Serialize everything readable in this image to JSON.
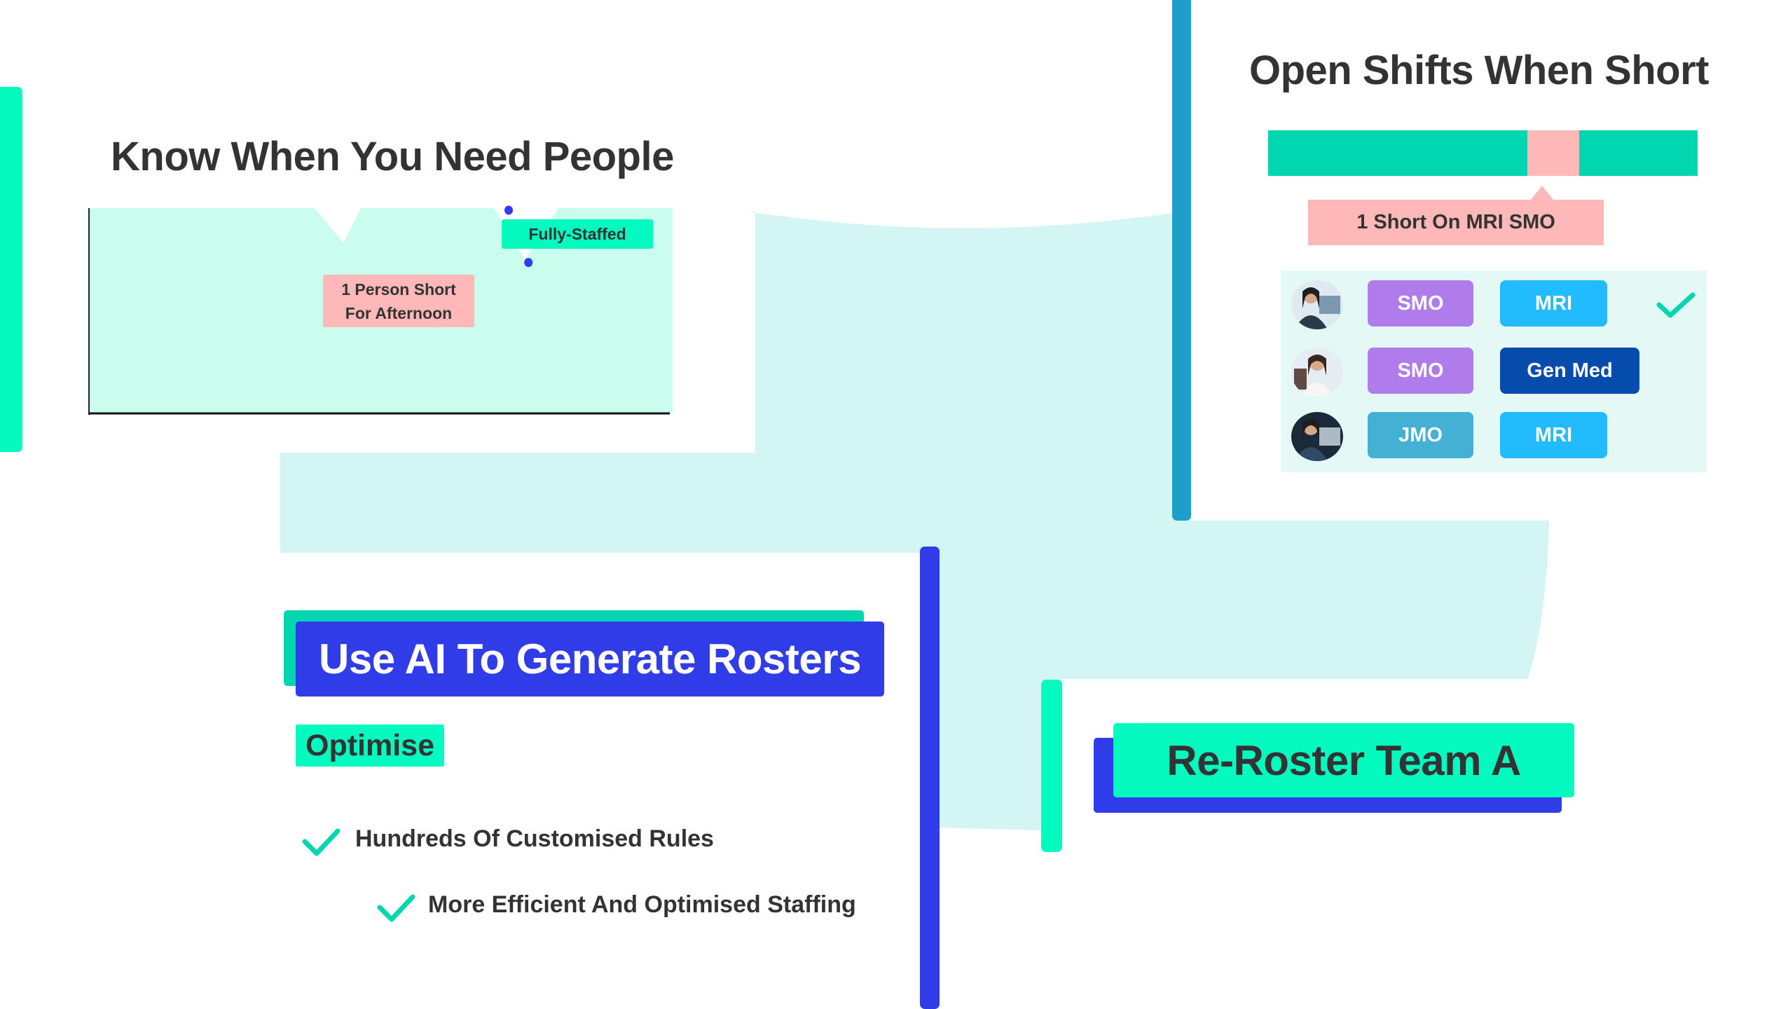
{
  "colors": {
    "mint": "#05fac0",
    "teal": "#02d6b0",
    "royal_blue": "#303ce8",
    "steel_blue": "#1e9ec8",
    "pale_cyan": "#d3f6f5",
    "chart_fill": "#cbfdee",
    "pink": "#ffb8b8",
    "text_dark": "#333333",
    "dot_blue": "#2d3cf0",
    "smo_purple": "#b07cec",
    "mri_sky": "#22bbfd",
    "genmed_navy": "#054cad",
    "jmo_blue": "#44b0d3",
    "panel_bg": "#e4f8f6"
  },
  "staffing_section": {
    "title": "Know When You Need People",
    "fully_staffed_label": "Fully-Staffed",
    "short_label_line1": "1 Person Short",
    "short_label_line2": "For Afternoon"
  },
  "chart_data": {
    "type": "area",
    "title": "Know When You Need People",
    "xlabel": "",
    "ylabel": "",
    "grid": false,
    "description": "Staffing level over the day; full level with two dips below full",
    "series": [
      {
        "name": "Staffing level",
        "points": [
          {
            "x": 0.0,
            "y": 1.0
          },
          {
            "x": 0.386,
            "y": 1.0
          },
          {
            "x": 0.436,
            "y": 0.83
          },
          {
            "x": 0.466,
            "y": 1.0
          },
          {
            "x": 0.694,
            "y": 1.0
          },
          {
            "x": 0.747,
            "y": 0.75
          },
          {
            "x": 0.804,
            "y": 1.0
          },
          {
            "x": 1.0,
            "y": 1.0
          }
        ]
      }
    ],
    "markers": [
      {
        "x": 0.753,
        "y": 0.735,
        "label": "1 Person Short For Afternoon"
      },
      {
        "x": 1.2,
        "y": 1.01,
        "label": "Fully-Staffed"
      }
    ],
    "xlim": [
      0,
      1
    ],
    "ylim": [
      0,
      1
    ]
  },
  "open_shifts_section": {
    "title": "Open Shifts When Short",
    "shift_bar": [
      {
        "kind": "covered",
        "fraction": 0.604
      },
      {
        "kind": "short",
        "fraction": 0.121
      },
      {
        "kind": "covered",
        "fraction": 0.275
      }
    ],
    "tooltip": "1 Short On MRI SMO",
    "roster": [
      {
        "avatar": "doctor-male-monitor-photo",
        "role": "SMO",
        "department": "MRI",
        "selected": true
      },
      {
        "avatar": "doctor-female-xray-photo",
        "role": "SMO",
        "department": "Gen Med",
        "selected": false
      },
      {
        "avatar": "doctor-female-scan-photo",
        "role": "JMO",
        "department": "MRI",
        "selected": false
      }
    ]
  },
  "ai_section": {
    "title": "Use AI To Generate Rosters",
    "tag": "Optimise",
    "features": [
      "Hundreds Of Customised Rules",
      "More Efficient And Optimised Staffing"
    ]
  },
  "reroster_section": {
    "button_label": "Re-Roster Team A"
  }
}
